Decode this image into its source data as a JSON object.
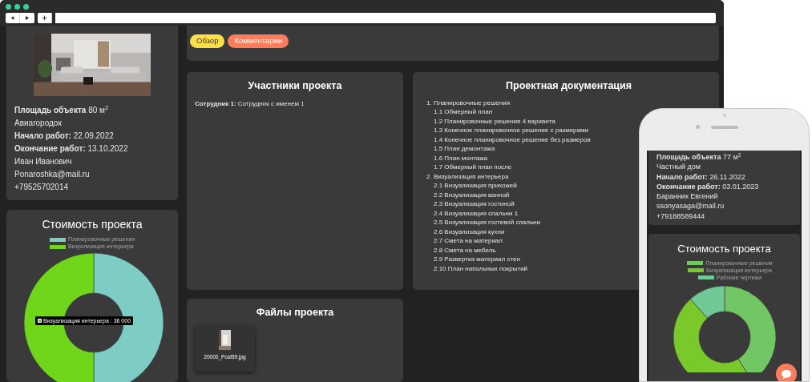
{
  "object_card": {
    "info": [
      "**Площадь объекта** 80 м$^{2}$",
      "Авиагородок",
      "**Начало работ:** 22.09.2022",
      "**Окончание работ:** 13.10.2022",
      "Иван Иванович",
      "Ponaroshka@mail.ru",
      "+79525702014"
    ]
  },
  "cost_card": {
    "title": "Стоимость проекта",
    "legend": [
      {
        "label": "Планировочные решения",
        "color": "#7ecdc4"
      },
      {
        "label": "Визуализация интерьера",
        "color": "#6fd61a"
      }
    ],
    "tooltip": "Визуализация интерьера : 36 000"
  },
  "tabs": [
    {
      "label": "Обзор",
      "color": "#fde047"
    },
    {
      "label": "Комментарии",
      "color": "#fb7d5b"
    }
  ],
  "participants": {
    "title": "Участники проекта",
    "lines": [
      "**Сотрудник 1:** Сотрудник с именем 1"
    ]
  },
  "files": {
    "title": "Файлы проекта",
    "items": [
      {
        "name": "20000_Post59.jpg"
      }
    ]
  },
  "docs": {
    "title": "Проектная документация",
    "items": [
      {
        "label": "1. Планировочные решения",
        "children": [
          {
            "label": "1.1 Обмерный план"
          },
          {
            "label": "1.2 Планировочные решения 4 варианта"
          },
          {
            "label": "1.3 Конечное планировочное решение с размерами"
          },
          {
            "label": "1.4 Конечное планировочное решение без размеров"
          },
          {
            "label": "1.5 План демонтажа"
          },
          {
            "label": "1.6 План монтажа"
          },
          {
            "label": "1.7 Обмерный план после"
          }
        ]
      },
      {
        "label": "2. Визуализация интерьера",
        "children": [
          {
            "label": "2.1 Визуализация прихожей"
          },
          {
            "label": "2.2 Визуализация ванной"
          },
          {
            "label": "2.3 Визуализация гостиной"
          },
          {
            "label": "2.4 Визуализация спальни 1"
          },
          {
            "label": "2.5 Визуализация гостевой спальни"
          },
          {
            "label": "2.6 Визуализация кухни"
          },
          {
            "label": "2.7 Смета на материал"
          },
          {
            "label": "2.8 Смета на мебель"
          },
          {
            "label": "2.9 Развертка материал стен"
          },
          {
            "label": "2.10 План напольных покрытий"
          }
        ]
      }
    ]
  },
  "phone": {
    "info": [
      "**Площадь объекта** 77 м$^{2}$",
      "Частный дом",
      "**Начало работ:** 26.11.2022",
      "**Окончание работ:** 03.01.2023",
      "Баранник Евгений",
      "ssonyasaga@mail.ru",
      "+79188589444"
    ],
    "cost": {
      "title": "Стоимость проекта",
      "legend": [
        {
          "label": "Планировочные решения",
          "color": "#72c765"
        },
        {
          "label": "Визуализация интерьера",
          "color": "#7ac92b"
        },
        {
          "label": "Рабочие чертежи",
          "color": "#6fc895"
        }
      ]
    }
  }
}
